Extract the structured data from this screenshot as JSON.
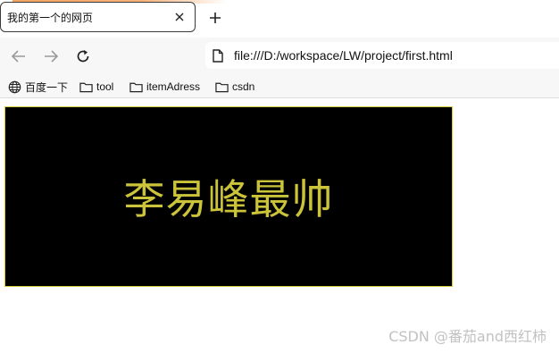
{
  "tab": {
    "title": "我的第一个的网页",
    "close_icon": "close-icon",
    "new_tab_icon": "plus-icon"
  },
  "toolbar": {
    "back_icon": "arrow-left-icon",
    "forward_icon": "arrow-right-icon",
    "reload_icon": "reload-icon",
    "url": "file:///D:/workspace/LW/project/first.html",
    "page_icon": "file-icon"
  },
  "bookmarks": [
    {
      "label": "百度一下",
      "icon": "globe-icon"
    },
    {
      "label": "tool",
      "icon": "folder-icon"
    },
    {
      "label": "itemAdress",
      "icon": "folder-icon"
    },
    {
      "label": "csdn",
      "icon": "folder-icon"
    }
  ],
  "page": {
    "headline": "李易峰最帅",
    "headline_color": "#cbc33a",
    "box_background": "#000000",
    "box_border_color": "#d4cc3c"
  },
  "watermark": "CSDN @番茄and西红柿",
  "colors": {
    "tab_accent": "#f4a460"
  }
}
